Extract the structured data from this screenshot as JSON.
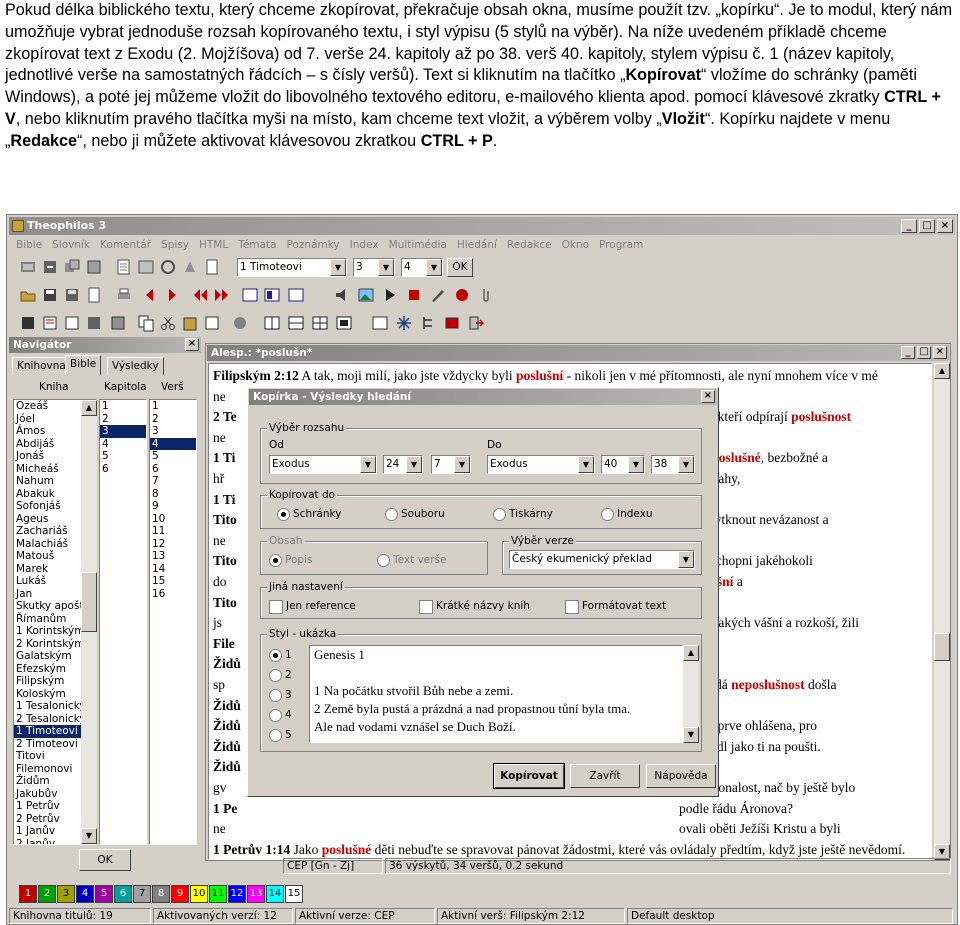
{
  "intro": {
    "p1": "Pokud délka biblického textu, který chceme zkopírovat, překračuje obsah okna, musíme použít tzv. „kopírku“. Je to modul, který nám umožňuje vybrat jednoduše rozsah kopírovaného textu, i styl výpisu (5 stylů na výběr). Na níže uvedeném příkladě chceme zkopírovat text z Exodu (2. Mojžíšova) od 7. verše 24. kapitoly až po 38. verš 40. kapitoly, stylem výpisu č. 1 (název kapitoly, jednotlivé verše na samostatných řádcích – s čísly veršů). Text si kliknutím na tlačítko „",
    "b1": "Kopírovat",
    "p2": "“ vložíme do schránky (paměti Windows), a poté jej můžeme vložit do libovolného textového editoru, e-mailového klienta apod. pomocí klávesové zkratky ",
    "b2": "CTRL + V",
    "p3": ", nebo kliknutím pravého tlačítka myši na místo, kam chceme text vložit, a výběrem volby „",
    "b3": "Vložit",
    "p4": "“. Kopírku najdete v menu „",
    "b4": "Redakce",
    "p5": "“, nebo ji můžete aktivovat klávesovou zkratkou ",
    "b5": "CTRL + P",
    "p6": "."
  },
  "app": {
    "title": "Theophilos 3",
    "title_buttons": [
      "_",
      "□",
      "×"
    ],
    "menu": [
      "Bible",
      "Slovník",
      "Komentář",
      "Spisy",
      "HTML",
      "Témata",
      "Poznámky",
      "Index",
      "Multimédia",
      "Hledání",
      "Redakce",
      "Okno",
      "Program"
    ],
    "toolbar": {
      "book": "1 Timoteovi",
      "chapter": "3",
      "verse": "4",
      "ok": "OK"
    }
  },
  "navigator": {
    "title": "Navigátor",
    "tabs": [
      "Knihovna",
      "Bible",
      "Výsledky"
    ],
    "col_books": "Kniha",
    "col_chapter": "Kapitola",
    "col_verse": "Verš",
    "books": [
      "Ozeáš",
      "Jóel",
      "Ámos",
      "Abdijáš",
      "Jonáš",
      "Micheáš",
      "Nahum",
      "Abakuk",
      "Sofonjáš",
      "Ageus",
      "Zachariáš",
      "Malachiáš",
      "Matouš",
      "Marek",
      "Lukáš",
      "Jan",
      "Skutky apošto",
      "Římanům",
      "1 Korintským",
      "2 Korintským",
      "Galatským",
      "Efezským",
      "Filipským",
      "Koloským",
      "1 Tesalonický",
      "2 Tesalonický",
      "1 Timoteovi",
      "2 Timoteovi",
      "Titovi",
      "Filemonovi",
      "Židům",
      "Jakubův",
      "1 Petrův",
      "2 Petrův",
      "1 Janův",
      "2 Janův"
    ],
    "selected_book": "1 Timoteovi",
    "chapters": [
      "1",
      "2",
      "3",
      "4",
      "5",
      "6"
    ],
    "selected_chapter": "3",
    "verses": [
      "1",
      "2",
      "3",
      "4",
      "5",
      "6",
      "7",
      "8",
      "9",
      "10",
      "11",
      "12",
      "13",
      "14",
      "15",
      "16"
    ],
    "selected_verse": "4",
    "ok": "OK"
  },
  "doc": {
    "title": "Alesp.: *poslušn*",
    "lines": [
      {
        "ref": "Filipským 2:12",
        "pre": "  A tak, moji milí, jako jste vždycky byli ",
        "hit": "poslušní",
        "post": " - nikoli jen v mé přítomnosti, ale nyní mnohem více v mé"
      },
      {
        "ref": "",
        "pre": "",
        "hit": "",
        "post": "ne"
      },
      {
        "ref": "2 Te",
        "pre": "",
        "hit": "",
        "post": ""
      },
      {
        "ref": "",
        "pre": "",
        "hit": "",
        "post": "ne"
      },
      {
        "ref": "1 Ti",
        "pre": "",
        "hit": "",
        "post": ""
      },
      {
        "ref": "",
        "pre": "",
        "hit": "",
        "post": "hř"
      },
      {
        "ref": "1 Ti",
        "pre": "",
        "hit": "",
        "post": ""
      },
      {
        "ref": "Tito",
        "pre": "",
        "hit": "",
        "post": ""
      },
      {
        "ref": "",
        "pre": "",
        "hit": "",
        "post": "ne"
      },
      {
        "ref": "Tito",
        "pre": "",
        "hit": "",
        "post": ""
      },
      {
        "ref": "",
        "pre": "",
        "hit": "",
        "post": "do"
      },
      {
        "ref": "Tito",
        "pre": "",
        "hit": "",
        "post": ""
      },
      {
        "ref": "",
        "pre": "",
        "hit": "",
        "post": "js"
      },
      {
        "ref": "File",
        "pre": "",
        "hit": "",
        "post": ""
      },
      {
        "ref": "Židů",
        "pre": "",
        "hit": "",
        "post": ""
      },
      {
        "ref": "",
        "pre": "",
        "hit": "",
        "post": "sp"
      },
      {
        "ref": "Židů",
        "pre": "",
        "hit": "",
        "post": ""
      },
      {
        "ref": "Židů",
        "pre": "",
        "hit": "",
        "post": ""
      },
      {
        "ref": "Židů",
        "pre": "",
        "hit": "",
        "post": ""
      },
      {
        "ref": "Židů",
        "pre": "",
        "hit": "",
        "post": ""
      },
      {
        "ref": "",
        "pre": "",
        "hit": "",
        "post": "gv"
      },
      {
        "ref": "1 Pe",
        "pre": "",
        "hit": "",
        "post": ""
      },
      {
        "ref": "",
        "pre": "",
        "hit": "",
        "post": "ne"
      },
      {
        "ref": "1 Petrův 1:14",
        "pre": "  Jako ",
        "hit": "poslušné",
        "post": " děti nebuďte se spravovat pánovat žádostmi, které vás ovládaly předtím, když jste ještě nevědomí."
      }
    ],
    "right_fragments": [
      {
        "text_pre": "",
        "hit": "",
        "text_post": "e",
        "row": 1
      },
      {
        "text_pre": "",
        "hit": "",
        "text_post": "a těch, kteří odpírají ",
        "hit2": "poslušnost",
        "row": 2
      },
      {
        "text_pre": "é a ",
        "hit": "neposlušné",
        "text_post": ", bezbožné a",
        "row": 4
      },
      {
        "text_pre": "",
        "hit": "",
        "text_post": ", pro vrahy,",
        "row": 5
      },
      {
        "text_pre": "",
        "hit": "",
        "text_post": "nedá vytknout nevázanost a",
        "row": 7
      },
      {
        "text_pre": "",
        "hit": "",
        "text_post": "á a neschopni jakéhokoli",
        "row": 9
      },
      {
        "text_pre": "",
        "hit": "",
        "text_post": "i ",
        "hit2": "poslušní",
        "text_post2": " a",
        "row": 10
      },
      {
        "text_pre": "",
        "hit": "",
        "text_post": "y všelijakých vášní a rozkoší, žili",
        "row": 12
      },
      {
        "text_pre": "",
        "hit": "",
        "text_post": "k i každá ",
        "hit2": "neposlušnost",
        "text_post2": " došla",
        "row": 15
      },
      {
        "text_pre": "",
        "hit": "",
        "text_post": "ebe nejprve ohlášena, pro",
        "row": 17
      },
      {
        "text_pre": "",
        "hit": "",
        "text_post": "i nespadl jako ti na poušti.",
        "row": 18
      },
      {
        "text_pre": "",
        "hit": "",
        "text_post": "ala dokonalost, nač by ještě bylo",
        "row": 20
      },
      {
        "text_pre": "",
        "hit": "",
        "text_post": "podle řádu Áronova?",
        "row": 21
      },
      {
        "text_pre": "",
        "hit": "",
        "text_post": "ovali oběti Ježíši Kristu a byli",
        "row": 22
      }
    ]
  },
  "dialog": {
    "title": "Kopírka - Výsledky hledání",
    "range_label": "Výběr rozsahu",
    "from_label": "Od",
    "to_label": "Do",
    "from_book": "Exodus",
    "from_chapter": "24",
    "from_verse": "7",
    "to_book": "Exodus",
    "to_chapter": "40",
    "to_verse": "38",
    "copy_to_label": "Kopírovat do",
    "copy_to": [
      "Schránky",
      "Souboru",
      "Tiskárny",
      "Indexu"
    ],
    "content_label": "Obsah",
    "content": [
      "Popis",
      "Text verše"
    ],
    "version_label": "Výběr verze",
    "version": "Český ekumenický překlad",
    "other_label": "Jiná nastavení",
    "other": [
      "Jen reference",
      "Krátké názvy knih",
      "Formátovat text"
    ],
    "style_label": "Styl - ukázka",
    "styles": [
      "1",
      "2",
      "3",
      "4",
      "5"
    ],
    "preview": [
      "Genesis 1",
      "",
      "1 Na počátku stvořil Bůh nebe a zemi.",
      "2 Země byla pustá a prázdná a nad propastnou tůní byla tma.",
      "Ale nad vodami vznášel se Duch Boží."
    ],
    "btn_copy": "Kopírovat",
    "btn_close": "Zavřít",
    "btn_help": "Nápověda"
  },
  "status": {
    "version": "CEP [Gn - Zj]",
    "results": "36 výskytů, 34 veršů, 0.2 sekund",
    "library": "Knihovna titulů: 19",
    "active_versions": "Aktivovaných verzí: 12",
    "active_version": "Aktivní verze: CEP",
    "active_verse": "Aktivní verš: Filipským 2:12",
    "desktop": "Default desktop"
  },
  "palette": [
    "1",
    "2",
    "3",
    "4",
    "5",
    "6",
    "7",
    "8",
    "9",
    "10",
    "11",
    "12",
    "13",
    "14",
    "15"
  ],
  "palette_colors": [
    "#c00000",
    "#00a000",
    "#a0a000",
    "#0000c0",
    "#a000a0",
    "#00a0a0",
    "#a0a0a0",
    "#808080",
    "#ff0000",
    "#ffff00",
    "#00ff00",
    "#0000ff",
    "#ff00ff",
    "#00ffff",
    "#ffffff"
  ]
}
